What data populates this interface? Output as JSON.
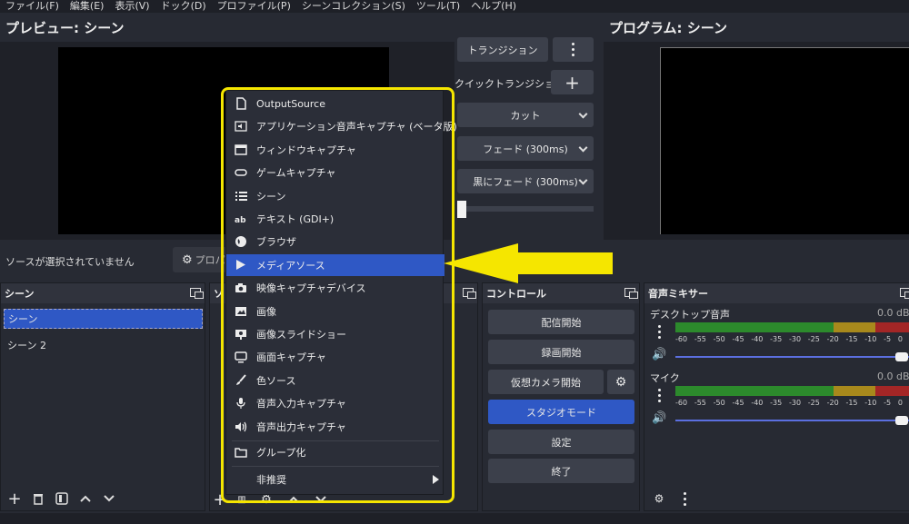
{
  "menubar": {
    "items": [
      "ファイル(F)",
      "編集(E)",
      "表示(V)",
      "ドック(D)",
      "プロファイル(P)",
      "シーンコレクション(S)",
      "ツール(T)",
      "ヘルプ(H)"
    ]
  },
  "preview": {
    "title": "プレビュー: シーン"
  },
  "program": {
    "title": "プログラム: シーン"
  },
  "transition": {
    "transition_label": "トランジション",
    "quick_transition_label": "クイックトランジション",
    "options": [
      "カット",
      "フェード (300ms)",
      "黒にフェード (300ms)"
    ]
  },
  "source_bar": {
    "no_source": "ソースが選択されていません",
    "properties_label": "プロパ"
  },
  "scenes": {
    "title": "シーン",
    "items": [
      "シーン",
      "シーン 2"
    ]
  },
  "sources": {
    "title": "ソ"
  },
  "controls": {
    "title": "コントロール",
    "buttons": [
      "配信開始",
      "録画開始",
      "仮想カメラ開始",
      "スタジオモード",
      "設定",
      "終了"
    ]
  },
  "mixer": {
    "title": "音声ミキサー",
    "channels": [
      {
        "name": "デスクトップ音声",
        "db": "0.0 dB"
      },
      {
        "name": "マイク",
        "db": "0.0 dB"
      }
    ],
    "scale": [
      "-60",
      "-55",
      "-50",
      "-45",
      "-40",
      "-35",
      "-30",
      "-25",
      "-20",
      "-15",
      "-10",
      "-5",
      "0"
    ]
  },
  "context_menu": {
    "items": [
      {
        "label": "OutputSource",
        "icon": "file-icon"
      },
      {
        "label": "アプリケーション音声キャプチャ (ベータ版)",
        "icon": "app-audio-icon"
      },
      {
        "label": "ウィンドウキャプチャ",
        "icon": "window-icon"
      },
      {
        "label": "ゲームキャプチャ",
        "icon": "gamepad-icon"
      },
      {
        "label": "シーン",
        "icon": "list-icon"
      },
      {
        "label": "テキスト (GDI+)",
        "icon": "text-icon"
      },
      {
        "label": "ブラウザ",
        "icon": "globe-icon"
      },
      {
        "label": "メディアソース",
        "icon": "play-icon",
        "selected": true
      },
      {
        "label": "映像キャプチャデバイス",
        "icon": "camera-icon"
      },
      {
        "label": "画像",
        "icon": "image-icon"
      },
      {
        "label": "画像スライドショー",
        "icon": "slideshow-icon"
      },
      {
        "label": "画面キャプチャ",
        "icon": "monitor-icon"
      },
      {
        "label": "色ソース",
        "icon": "brush-icon"
      },
      {
        "label": "音声入力キャプチャ",
        "icon": "mic-icon"
      },
      {
        "label": "音声出力キャプチャ",
        "icon": "speaker-icon"
      }
    ],
    "group_label": "グループ化",
    "deprecated_label": "非推奨"
  },
  "colors": {
    "highlight": "#f5e600",
    "selection": "#2f58c5",
    "studio_mode": "#2f58c5",
    "meter_green": "#2c8a2c",
    "meter_yellow": "#a8891c",
    "meter_red": "#a32626"
  }
}
